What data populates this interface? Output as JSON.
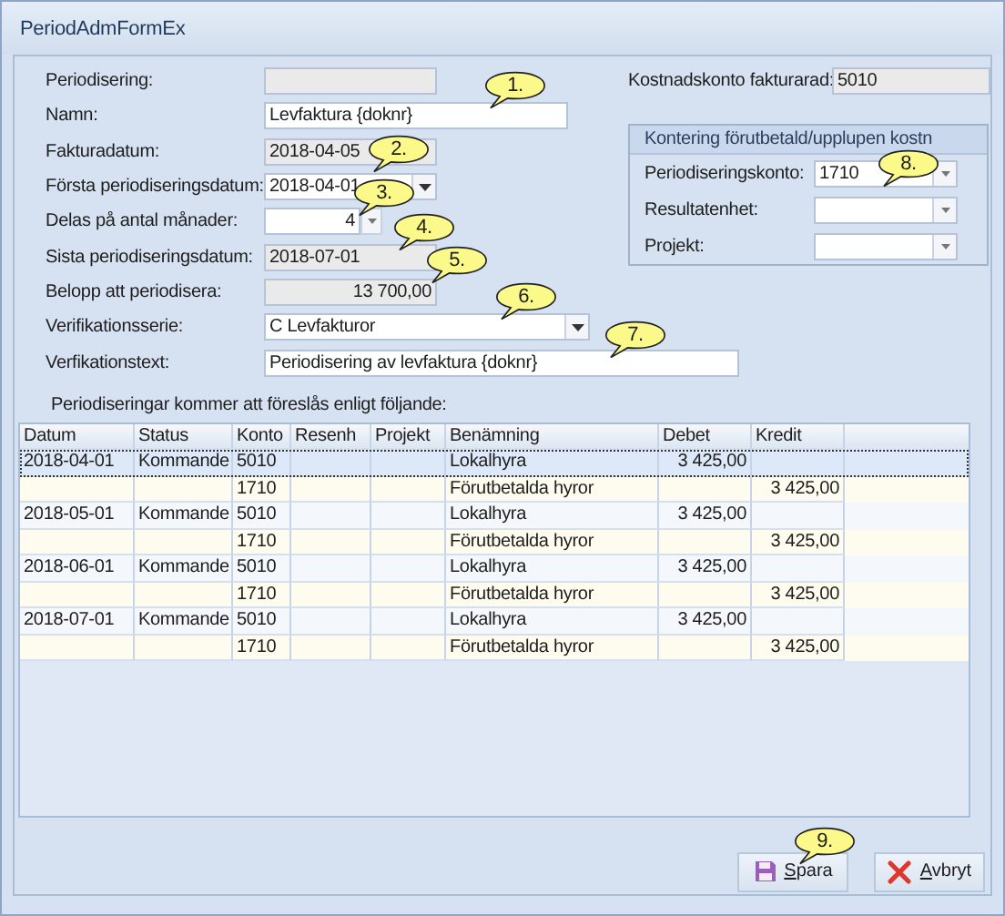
{
  "window": {
    "title": "PeriodAdmFormEx"
  },
  "fields": [
    {
      "label": "Periodisering:",
      "kind": "readonly"
    },
    {
      "label": "Namn:",
      "kind": "text",
      "value": "Levfaktura {doknr}"
    },
    {
      "label": "Fakturadatum:",
      "kind": "readonly",
      "value": "2018-04-05"
    },
    {
      "label": "Första periodiseringsdatum:",
      "kind": "combo",
      "value": "2018-04-01"
    },
    {
      "label": "Delas på antal månader:",
      "kind": "spin",
      "value": "4"
    },
    {
      "label": "Sista periodiseringsdatum:",
      "kind": "readonly",
      "value": "2018-07-01"
    },
    {
      "label": "Belopp att periodisera:",
      "kind": "amount",
      "value": "13 700,00"
    },
    {
      "label": "Verifikationsserie:",
      "kind": "combo",
      "value": "C Levfakturor"
    },
    {
      "label": "Verfikationstext:",
      "kind": "text",
      "value": "Periodisering av levfaktura {doknr}"
    }
  ],
  "cost_account": {
    "label": "Kostnadskonto fakturarad:",
    "value": "5010"
  },
  "group": {
    "title": "Kontering förutbetald/upplupen kostn",
    "fields": [
      {
        "label": "Periodiseringskonto:",
        "value": "1710"
      },
      {
        "label": "Resultatenhet:"
      },
      {
        "label": "Projekt:"
      }
    ]
  },
  "table_caption": "Periodiseringar kommer att föreslås enligt följande:",
  "table": {
    "columns": [
      "Datum",
      "Status",
      "Konto",
      "Resenh",
      "Projekt",
      "Benämning",
      "Debet",
      "Kredit"
    ],
    "rows": [
      {
        "selected": true,
        "cells": [
          "2018-04-01",
          "Kommande",
          "5010",
          null,
          null,
          "Lokalhyra",
          "3 425,00",
          null
        ]
      },
      {
        "selected": false,
        "cells": [
          null,
          null,
          "1710",
          null,
          null,
          "Förutbetalda hyror",
          null,
          "3 425,00"
        ]
      },
      {
        "selected": false,
        "cells": [
          "2018-05-01",
          "Kommande",
          "5010",
          null,
          null,
          "Lokalhyra",
          "3 425,00",
          null
        ]
      },
      {
        "selected": false,
        "cells": [
          null,
          null,
          "1710",
          null,
          null,
          "Förutbetalda hyror",
          null,
          "3 425,00"
        ]
      },
      {
        "selected": false,
        "cells": [
          "2018-06-01",
          "Kommande",
          "5010",
          null,
          null,
          "Lokalhyra",
          "3 425,00",
          null
        ]
      },
      {
        "selected": false,
        "cells": [
          null,
          null,
          "1710",
          null,
          null,
          "Förutbetalda hyror",
          null,
          "3 425,00"
        ]
      },
      {
        "selected": false,
        "cells": [
          "2018-07-01",
          "Kommande",
          "5010",
          null,
          null,
          "Lokalhyra",
          "3 425,00",
          null
        ]
      },
      {
        "selected": false,
        "cells": [
          null,
          null,
          "1710",
          null,
          null,
          "Förutbetalda hyror",
          null,
          "3 425,00"
        ]
      }
    ]
  },
  "buttons": [
    {
      "kind": "save",
      "label": "Spara"
    },
    {
      "kind": "cancel",
      "label": "Avbryt"
    }
  ],
  "callouts": [
    "1.",
    "2.",
    "3.",
    "4.",
    "5.",
    "6.",
    "7.",
    "8.",
    "9."
  ]
}
